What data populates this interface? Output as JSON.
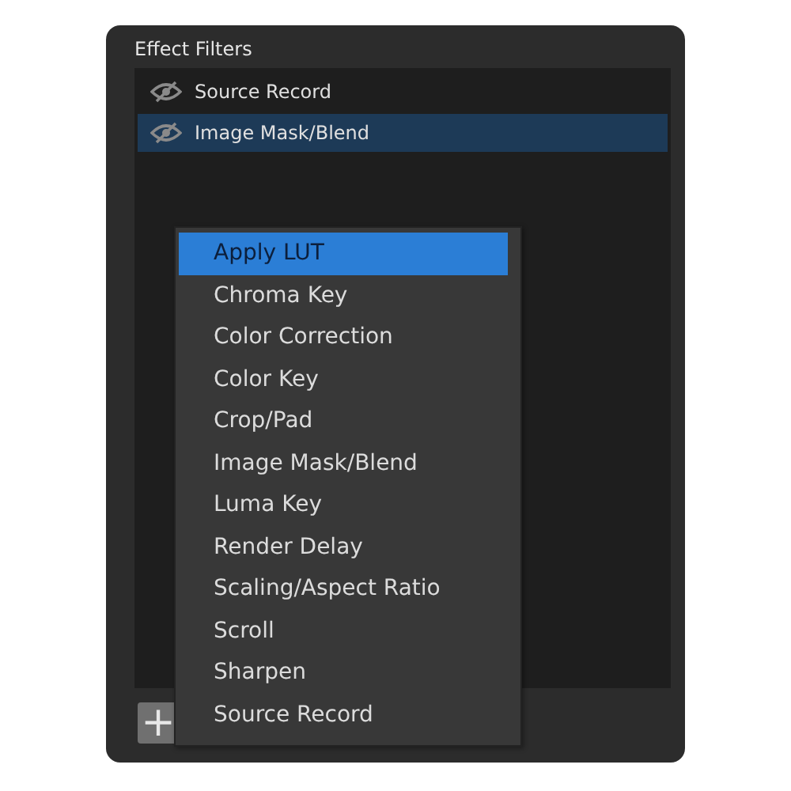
{
  "panel": {
    "title": "Effect Filters"
  },
  "filters": [
    {
      "label": "Source Record",
      "selected": false,
      "visible": false
    },
    {
      "label": "Image Mask/Blend",
      "selected": true,
      "visible": false
    }
  ],
  "add_button": {
    "label": "+"
  },
  "menu": [
    {
      "label": "Apply LUT",
      "selected": true
    },
    {
      "label": "Chroma Key",
      "selected": false
    },
    {
      "label": "Color Correction",
      "selected": false
    },
    {
      "label": "Color Key",
      "selected": false
    },
    {
      "label": "Crop/Pad",
      "selected": false
    },
    {
      "label": "Image Mask/Blend",
      "selected": false
    },
    {
      "label": "Luma Key",
      "selected": false
    },
    {
      "label": "Render Delay",
      "selected": false
    },
    {
      "label": "Scaling/Aspect Ratio",
      "selected": false
    },
    {
      "label": "Scroll",
      "selected": false
    },
    {
      "label": "Sharpen",
      "selected": false
    },
    {
      "label": "Source Record",
      "selected": false
    }
  ]
}
